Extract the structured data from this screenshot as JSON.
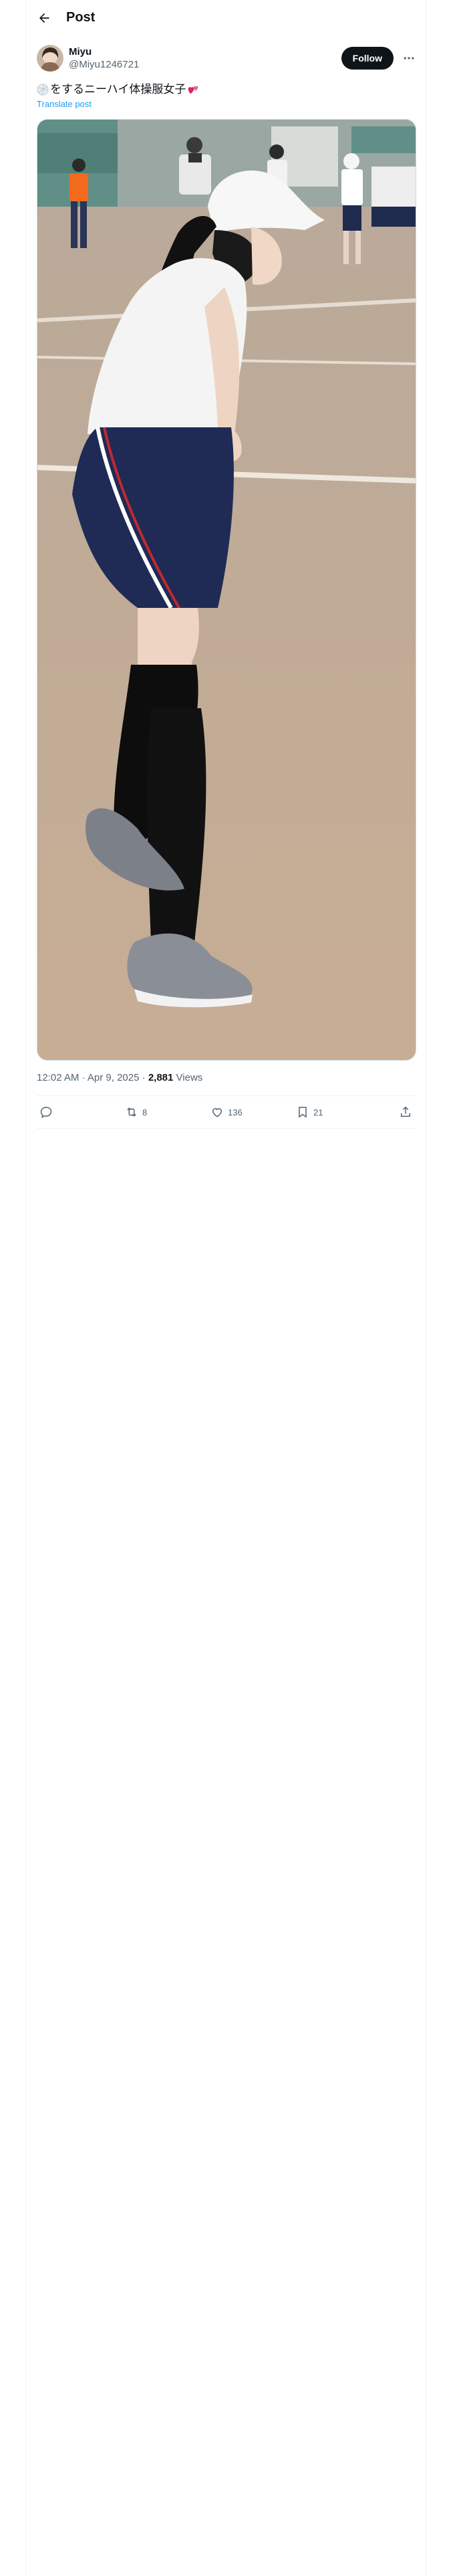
{
  "header": {
    "back_icon": "arrow-left-icon",
    "title": "Post"
  },
  "author": {
    "display_name": "Miyu",
    "handle": "@Miyu1246721",
    "follow_label": "Follow",
    "more_icon": "more-horizontal-icon"
  },
  "post": {
    "text": "をするニーハイ体操服女子",
    "translate_label": "Translate post",
    "media_alt": "Photo of a student in a white cap, white t-shirt, navy shorts and black knee-high socks on a school sports ground"
  },
  "meta": {
    "time": "12:02 AM",
    "separator": "·",
    "date": "Apr 9, 2025",
    "views_count": "2,881",
    "views_label": "Views"
  },
  "actions": {
    "reply_icon": "reply-icon",
    "repost_icon": "repost-icon",
    "repost_count": "8",
    "like_icon": "heart-icon",
    "like_count": "136",
    "bookmark_icon": "bookmark-icon",
    "bookmark_count": "21",
    "share_icon": "share-icon"
  },
  "colors": {
    "accent": "#1d9bf0",
    "text": "#0f1419",
    "muted": "#536471",
    "border": "#eff3f4"
  }
}
